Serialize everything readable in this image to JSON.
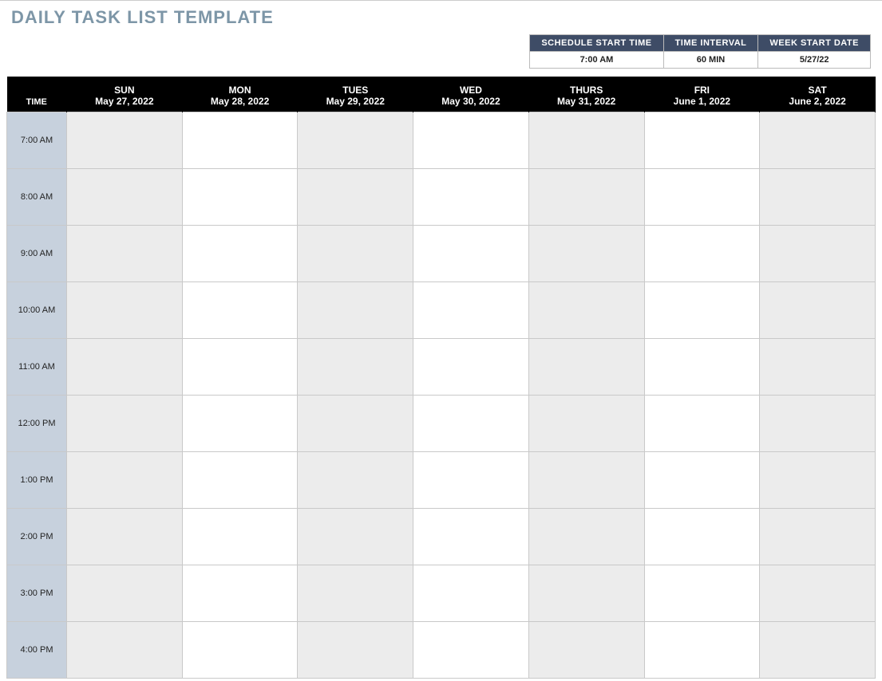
{
  "title": "DAILY TASK LIST TEMPLATE",
  "meta": {
    "headers": [
      "SCHEDULE START TIME",
      "TIME INTERVAL",
      "WEEK START DATE"
    ],
    "values": [
      "7:00 AM",
      "60 MIN",
      "5/27/22"
    ]
  },
  "schedule": {
    "time_header": "TIME",
    "days": [
      {
        "dow": "SUN",
        "date": "May 27, 2022"
      },
      {
        "dow": "MON",
        "date": "May 28, 2022"
      },
      {
        "dow": "TUES",
        "date": "May 29, 2022"
      },
      {
        "dow": "WED",
        "date": "May 30, 2022"
      },
      {
        "dow": "THURS",
        "date": "May 31, 2022"
      },
      {
        "dow": "FRI",
        "date": "June 1, 2022"
      },
      {
        "dow": "SAT",
        "date": "June 2, 2022"
      }
    ],
    "times": [
      "7:00 AM",
      "8:00 AM",
      "9:00 AM",
      "10:00 AM",
      "11:00 AM",
      "12:00 PM",
      "1:00 PM",
      "2:00 PM",
      "3:00 PM",
      "4:00 PM"
    ]
  }
}
